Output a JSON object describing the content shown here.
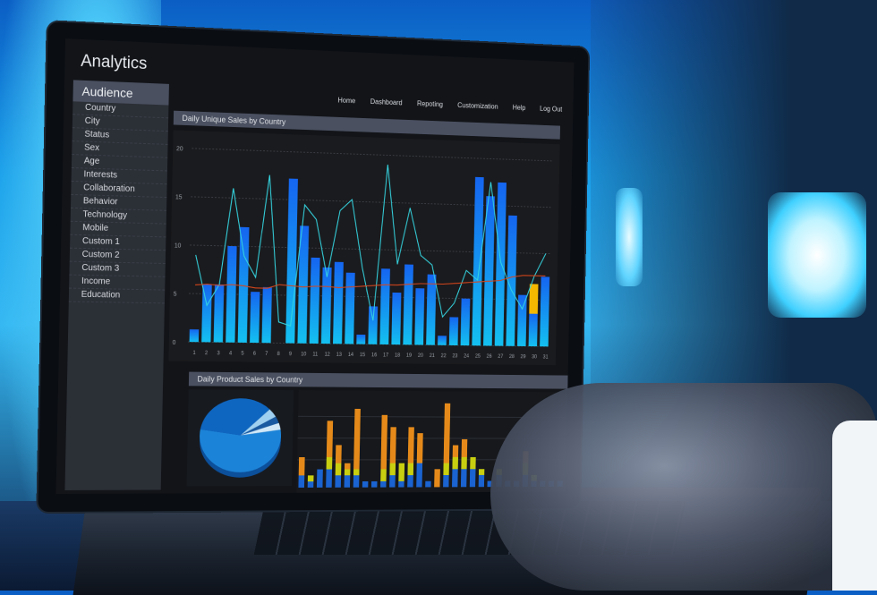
{
  "scene": {
    "description": "Laptop on desk showing an analytics dashboard, hand on keyboard, blue-lit background"
  },
  "app": {
    "title": "Analytics",
    "nav": [
      "Home",
      "Dashboard",
      "Repoting",
      "Customization",
      "Help",
      "Log Out"
    ]
  },
  "sidebar": {
    "header": "Audience",
    "items": [
      "Country",
      "City",
      "Status",
      "Sex",
      "Age",
      "Interests",
      "Collaboration",
      "Behavior",
      "Technology",
      "Mobile",
      "Custom 1",
      "Custom 2",
      "Custom 3",
      "Income",
      "Education"
    ]
  },
  "panels": {
    "top_title": "Daily Unique Sales by Country",
    "bottom_title": "Daily Product Sales by Country"
  },
  "colors": {
    "bar_top": "#1565f0",
    "bar_bottom": "#14c0f0",
    "highlight": "#f5b800",
    "line_cyan": "#35d4e0",
    "line_red": "#d8461c",
    "line_white": "#e8eef5"
  },
  "chart_data": [
    {
      "type": "bar",
      "title": "Daily Unique Sales by Country",
      "categories": [
        "1",
        "2",
        "3",
        "4",
        "5",
        "6",
        "7",
        "8",
        "9",
        "10",
        "11",
        "12",
        "13",
        "14",
        "15",
        "16",
        "17",
        "18",
        "19",
        "20",
        "21",
        "22",
        "23",
        "24",
        "25",
        "26",
        "27",
        "28",
        "29",
        "30",
        "31"
      ],
      "ylim": [
        0,
        20
      ],
      "yticks": [
        0,
        5,
        10,
        15,
        20
      ],
      "series": [
        {
          "name": "bars",
          "values": [
            1.3,
            6,
            6,
            10,
            12,
            5.3,
            5.8,
            0,
            17.2,
            12.3,
            9,
            8,
            8.6,
            7.5,
            1,
            4,
            8,
            5.5,
            8.5,
            6,
            7.5,
            1,
            3,
            5,
            18,
            16,
            17.5,
            14,
            5.5,
            3.5,
            7.5
          ]
        },
        {
          "name": "cyan-line",
          "values": [
            9,
            3.8,
            6,
            16,
            9,
            6.8,
            17.5,
            2.2,
            1.8,
            14.5,
            13,
            7,
            14,
            15.2,
            8,
            2.5,
            19,
            8.5,
            14.5,
            9.5,
            8.5,
            3,
            4.5,
            8,
            7,
            17.5,
            9,
            6,
            4,
            7.5,
            10
          ]
        },
        {
          "name": "average-line",
          "values": [
            5.9,
            6,
            5.9,
            6,
            5.9,
            5.7,
            5.7,
            6.1,
            6,
            5.9,
            6,
            6,
            5.9,
            6,
            6.1,
            6.2,
            6.3,
            6.3,
            6.4,
            6.5,
            6.5,
            6.5,
            6.6,
            6.7,
            6.8,
            6.9,
            7,
            7.4,
            7.6,
            7.6,
            7.6
          ]
        }
      ],
      "highlight": {
        "category": "30",
        "extra_value": 3.2
      }
    },
    {
      "type": "pie",
      "title": "Daily Product Sales by Country",
      "slices": [
        55,
        35,
        4,
        3,
        3
      ]
    },
    {
      "type": "bar",
      "stacked": true,
      "title": "Daily Product Sales by Country",
      "series": [
        {
          "name": "blue",
          "values": [
            2,
            1,
            3,
            3,
            2,
            2,
            2,
            1,
            1,
            1,
            2,
            1,
            2,
            4,
            1,
            0,
            2,
            3,
            3,
            3,
            2,
            1,
            2,
            1,
            1,
            2,
            1,
            1,
            1,
            1
          ]
        },
        {
          "name": "yellow",
          "values": [
            0,
            1,
            0,
            2,
            2,
            1,
            1,
            0,
            0,
            2,
            2,
            3,
            2,
            0,
            0,
            0,
            2,
            2,
            2,
            2,
            1,
            0,
            1,
            0,
            0,
            2,
            1,
            0,
            0,
            0
          ]
        },
        {
          "name": "orange",
          "values": [
            3,
            0,
            0,
            6,
            3,
            1,
            10,
            0,
            0,
            9,
            6,
            0,
            6,
            5,
            0,
            3,
            10,
            2,
            3,
            0,
            0,
            0,
            0,
            0,
            0,
            2,
            0,
            0,
            0,
            0
          ]
        }
      ]
    }
  ]
}
